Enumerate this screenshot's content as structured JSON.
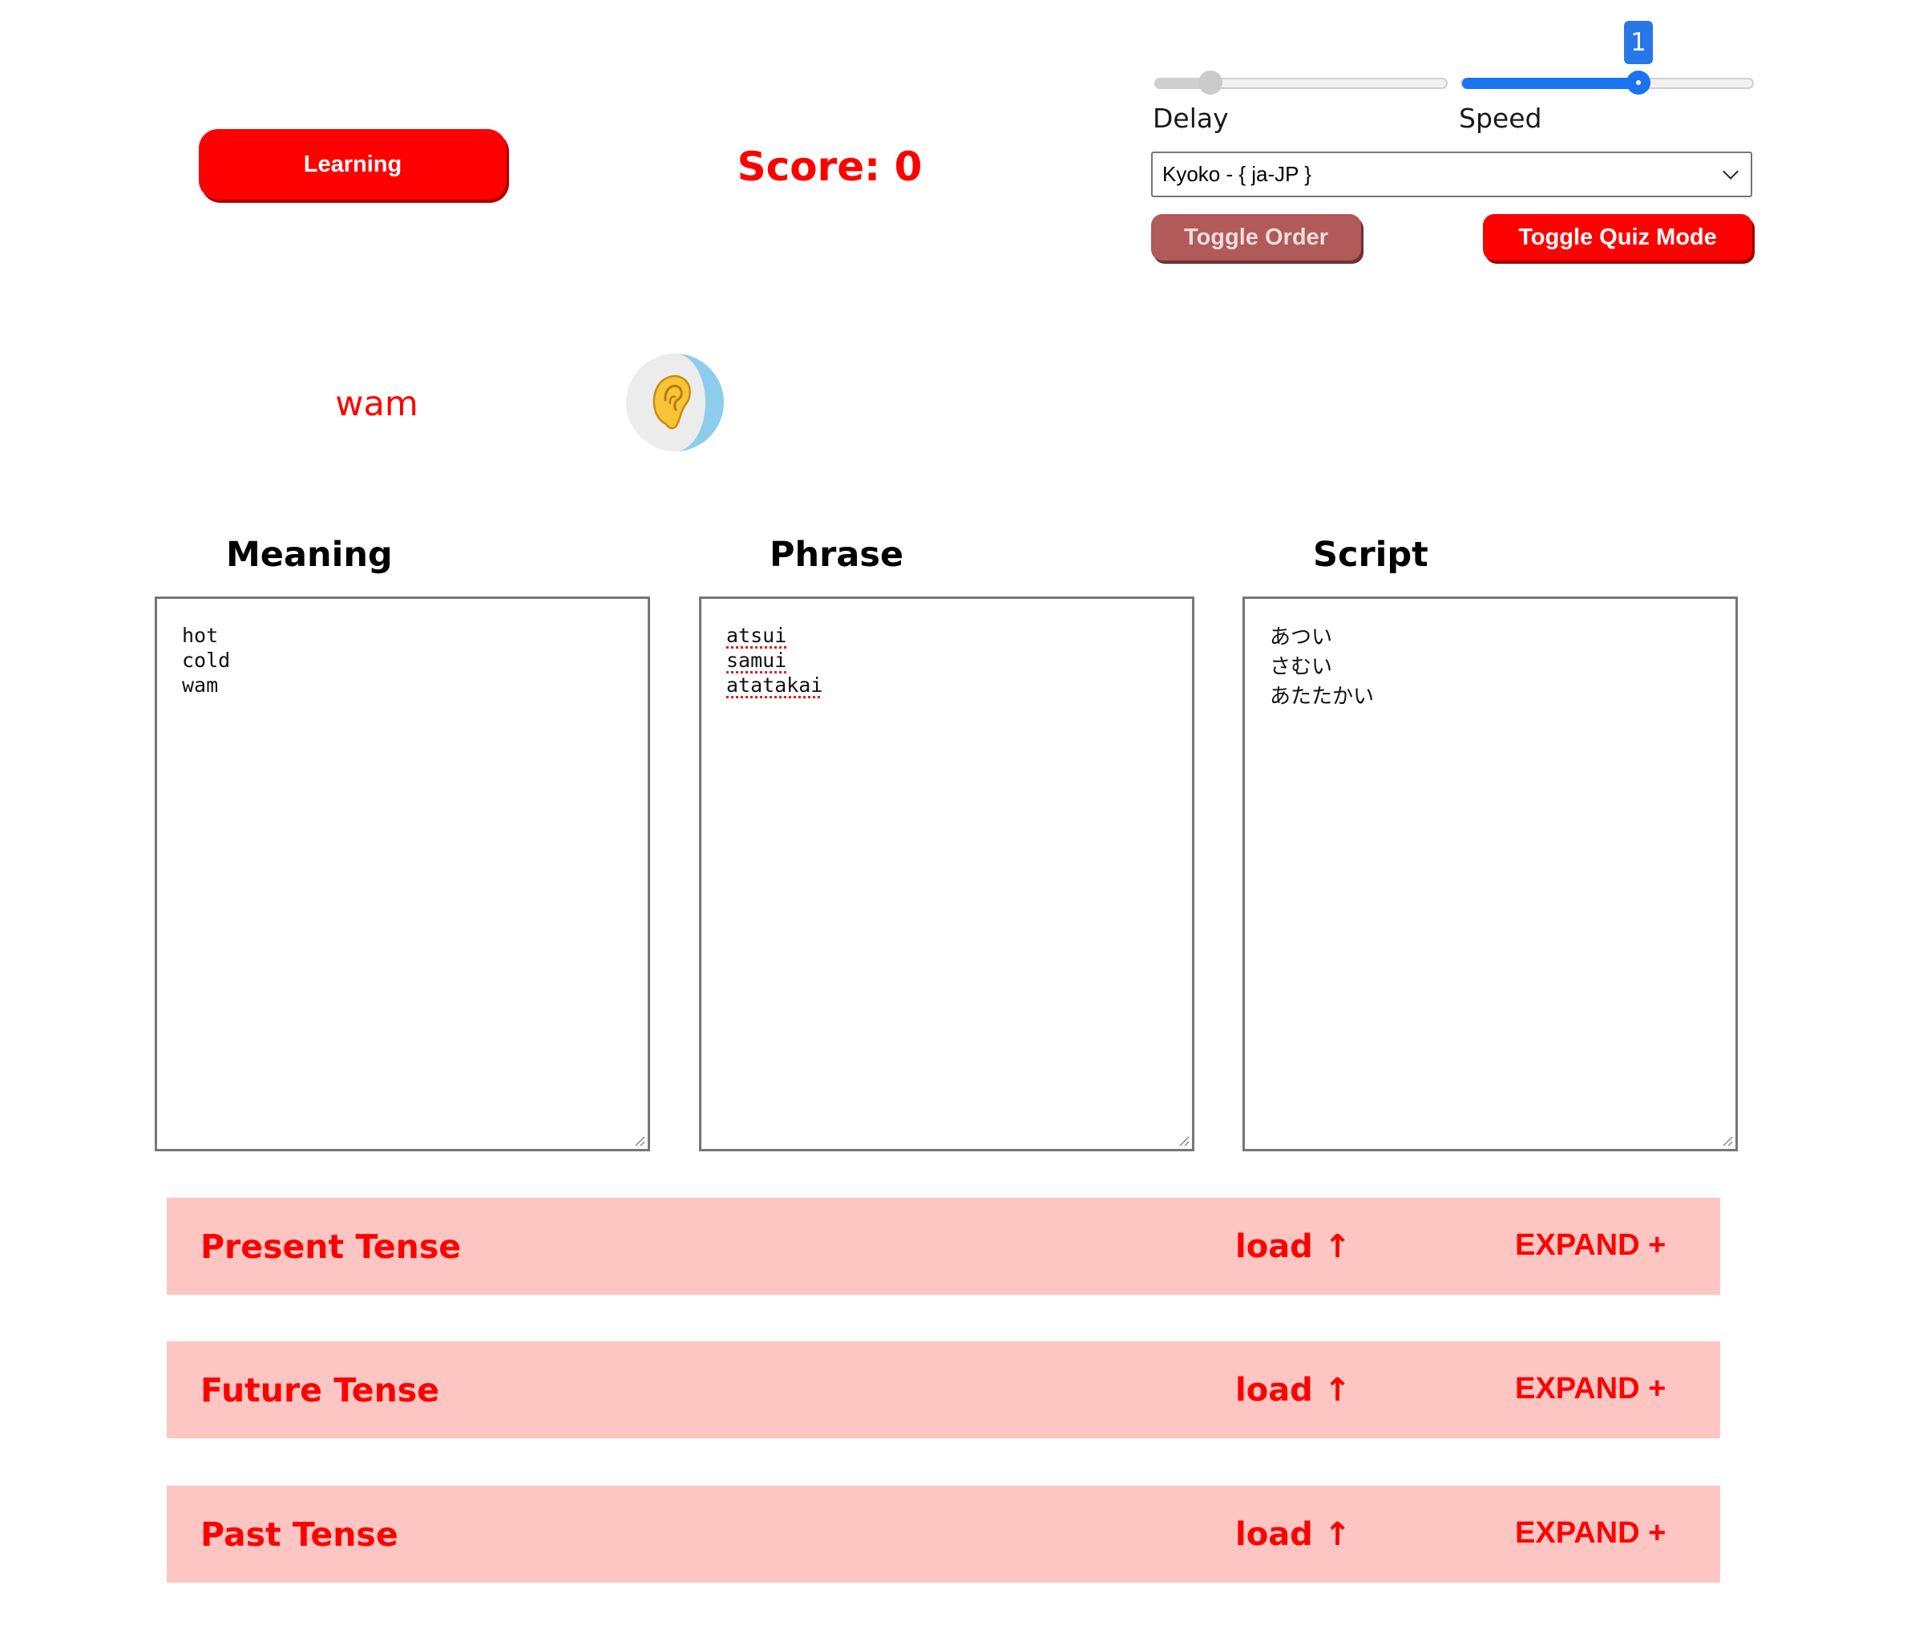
{
  "header": {
    "mode_button_label": "Learning",
    "score_text": "Score: 0"
  },
  "controls": {
    "delay_label": "Delay",
    "speed_label": "Speed",
    "speed_tooltip": "1",
    "delay_level": 0.06,
    "speed_level": 0.6,
    "voice_selected": "Kyoko - { ja-JP }",
    "toggle_order_label": "Toggle Order",
    "toggle_quiz_label": "Toggle Quiz Mode"
  },
  "current": {
    "word": "wam",
    "listen_icon": "ear-icon"
  },
  "columns": {
    "meaning": {
      "title": "Meaning",
      "lines": [
        "hot",
        "cold",
        "wam"
      ]
    },
    "phrase": {
      "title": "Phrase",
      "lines": [
        "atsui",
        "samui",
        "atatakai"
      ]
    },
    "script": {
      "title": "Script",
      "lines": [
        "あつい",
        "さむい",
        "あたたかい"
      ]
    }
  },
  "tenses": [
    {
      "title": "Present Tense",
      "load_label": "load ↑",
      "expand_label": "EXPAND +"
    },
    {
      "title": "Future Tense",
      "load_label": "load ↑",
      "expand_label": "EXPAND +"
    },
    {
      "title": "Past Tense",
      "load_label": "load ↑",
      "expand_label": "EXPAND +"
    }
  ],
  "colors": {
    "accent": "#ff0000",
    "tense_bar": "#fdc6c2",
    "slider_active": "#1a73f0",
    "toggle_order_bg": "#b05a5a"
  }
}
